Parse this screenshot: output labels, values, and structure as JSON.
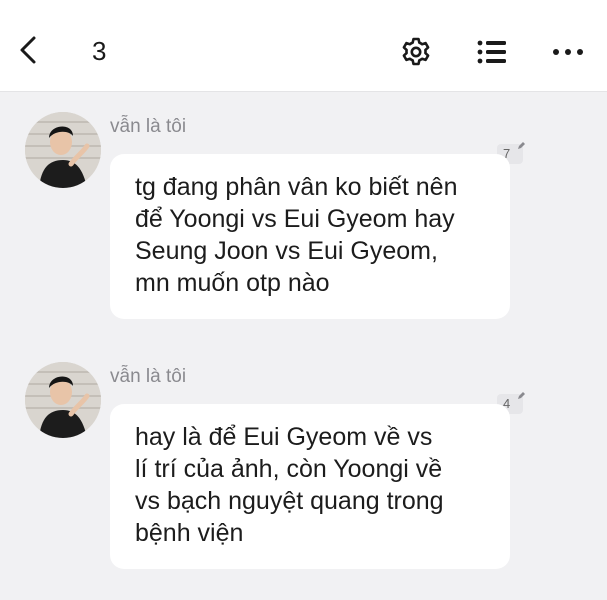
{
  "header": {
    "back_icon": "chevron-left-icon",
    "title": "3",
    "settings_icon": "gear-icon",
    "list_icon": "list-icon",
    "more_icon": "more-horizontal-icon"
  },
  "messages": [
    {
      "sender": "vẫn là tôi",
      "comment_count": "7",
      "lines": [
        "tg đang phân vân ko biết nên",
        "để Yoongi vs Eui Gyeom hay",
        "Seung Joon vs Eui Gyeom,",
        "mn muốn otp nào"
      ]
    },
    {
      "sender": "vẫn là tôi",
      "comment_count": "4",
      "lines": [
        "hay là để Eui Gyeom về vs",
        "lí trí của ảnh, còn Yoongi về",
        "vs bạch nguyệt quang trong",
        "bệnh viện"
      ]
    }
  ],
  "colors": {
    "background": "#f1f1f3",
    "bubble": "#ffffff",
    "sender_text": "#8a8a8f",
    "message_text": "#1c1c1c"
  }
}
